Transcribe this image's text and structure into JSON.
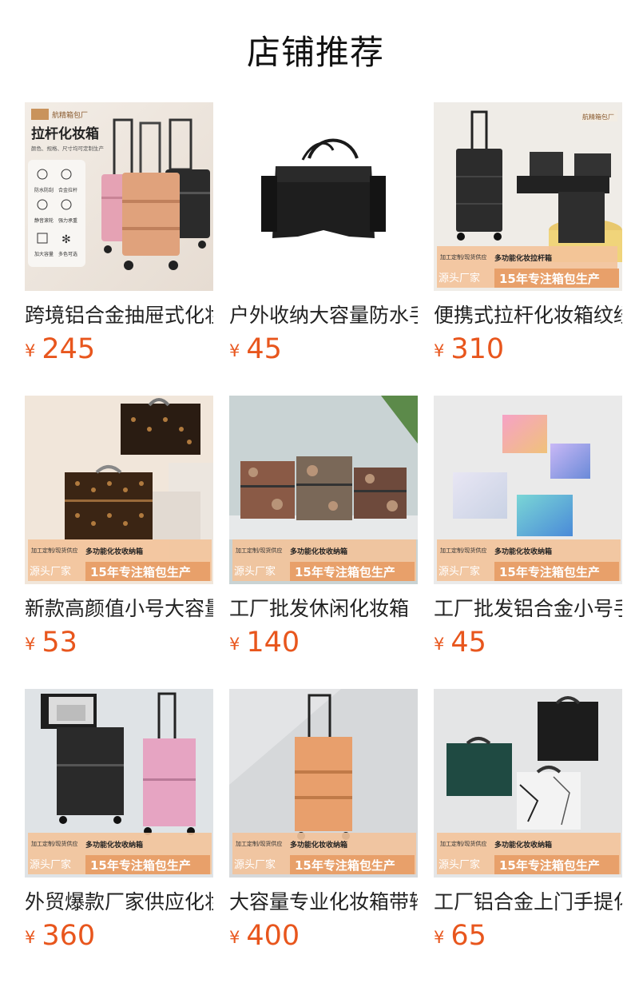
{
  "header": {
    "title": "店铺推荐"
  },
  "colors": {
    "price": "#e8561d",
    "banner_orange": "#e8a06a"
  },
  "banner": {
    "top": "加工定制/现货供应",
    "tag": "多功能化妆收纳箱",
    "left": "源头厂家",
    "right": "15年专注箱包生产"
  },
  "products": [
    {
      "name": "跨境铝合金抽屉式化妆箱",
      "currency": "¥",
      "price": "245",
      "image": "pink-gold-black-trolley-cases",
      "image_text": {
        "logo": "航精箱包厂",
        "heading": "拉杆化妆箱",
        "sub": "颜色、规格、尺寸均可定制生产",
        "features": [
          "防水防刮",
          "合金拉杆",
          "静音滚轮",
          "强力承重",
          "加大容量",
          "多色可选"
        ]
      }
    },
    {
      "name": "户外收纳大容量防水手提袋",
      "currency": "¥",
      "price": "45",
      "image": "black-tote-bag"
    },
    {
      "name": "便携式拉杆化妆箱纹绣",
      "currency": "¥",
      "price": "310",
      "image": "black-trolley-cases-open",
      "image_text": {
        "logo": "航精箱包厂",
        "tag": "多功能化妆拉杆箱",
        "left": "源头厂家",
        "right": "15年专注箱包生产",
        "top": "加工定制/现货供应"
      }
    },
    {
      "name": "新款高颜值小号大容量",
      "currency": "¥",
      "price": "53",
      "image": "brown-monogram-cases"
    },
    {
      "name": "工厂批发休闲化妆箱",
      "currency": "¥",
      "price": "140",
      "image": "camouflage-trolley-cases"
    },
    {
      "name": "工厂批发铝合金小号手提",
      "currency": "¥",
      "price": "45",
      "image": "holographic-cases"
    },
    {
      "name": "外贸爆款厂家供应化妆箱",
      "currency": "¥",
      "price": "360",
      "image": "black-pink-trolley-cases"
    },
    {
      "name": "大容量专业化妆箱带轮",
      "currency": "¥",
      "price": "400",
      "image": "orange-trolley-case"
    },
    {
      "name": "工厂铝合金上门手提化妆箱",
      "currency": "¥",
      "price": "65",
      "image": "green-marble-black-cases"
    }
  ]
}
